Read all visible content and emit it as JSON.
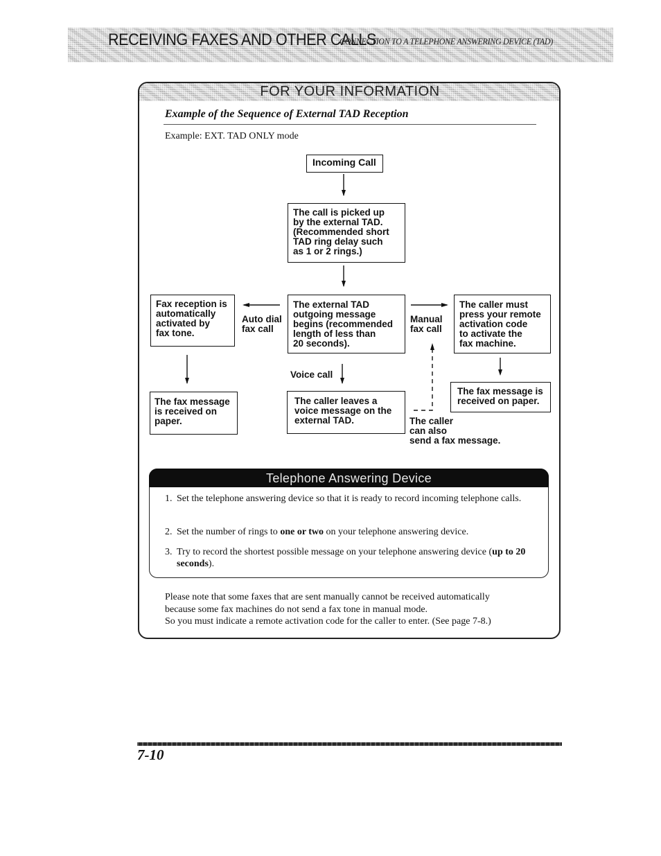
{
  "header": {
    "chapter_title": "RECEIVING FAXES AND OTHER CALLS",
    "section_title": "CONNECTION TO A TELEPHONE ANSWERING DEVICE (TAD)"
  },
  "info_panel": {
    "title": "FOR YOUR INFORMATION",
    "subtitle": "Example of the Sequence of External TAD Reception",
    "example_mode": "Example: EXT. TAD ONLY mode"
  },
  "flowchart": {
    "nodes": {
      "incoming_call": "Incoming Call",
      "picked_up": "The call is picked up\nby the external TAD.\n(Recommended short\n TAD ring delay such\n as 1 or 2 rings.)",
      "fax_auto": "Fax reception is\nautomatically\nactivated by\nfax tone.",
      "outgoing_message": "The external TAD\noutgoing message\nbegins (recommended\nlength of less than\n20 seconds).",
      "remote_code": "The caller must\npress your remote\nactivation code\nto activate the\nfax machine.",
      "fax_received_left": "The fax message\nis received on\npaper.",
      "voice_message": "The caller leaves a\nvoice message on the\nexternal TAD.",
      "fax_received_right": "The fax message is\nreceived on paper."
    },
    "labels": {
      "auto_dial": "Auto dial\nfax call",
      "manual": "Manual\nfax call",
      "voice_call": "Voice call",
      "caller_also": "The caller\ncan also\nsend a fax message."
    }
  },
  "tad_panel": {
    "title": "Telephone Answering Device",
    "items": [
      {
        "num": "1.",
        "text": "Set the telephone answering device so that it is ready to record incoming telephone calls."
      },
      {
        "num": "2.",
        "text_before": "Set the number of rings to ",
        "bold": "one or two",
        "text_after": " on your telephone answering device."
      },
      {
        "num": "3.",
        "text_before": "Try to record the shortest possible message on your telephone answering device (",
        "bold": "up to 20 seconds",
        "text_after": ")."
      }
    ]
  },
  "note": {
    "lines": [
      "Please note that some faxes that are sent manually cannot be received automatically",
      "because some fax machines do not send a fax tone in manual mode.",
      "So you must indicate a remote activation code for the caller to enter. (See page 7-8.)"
    ]
  },
  "footer": {
    "page_number": "7-10"
  }
}
